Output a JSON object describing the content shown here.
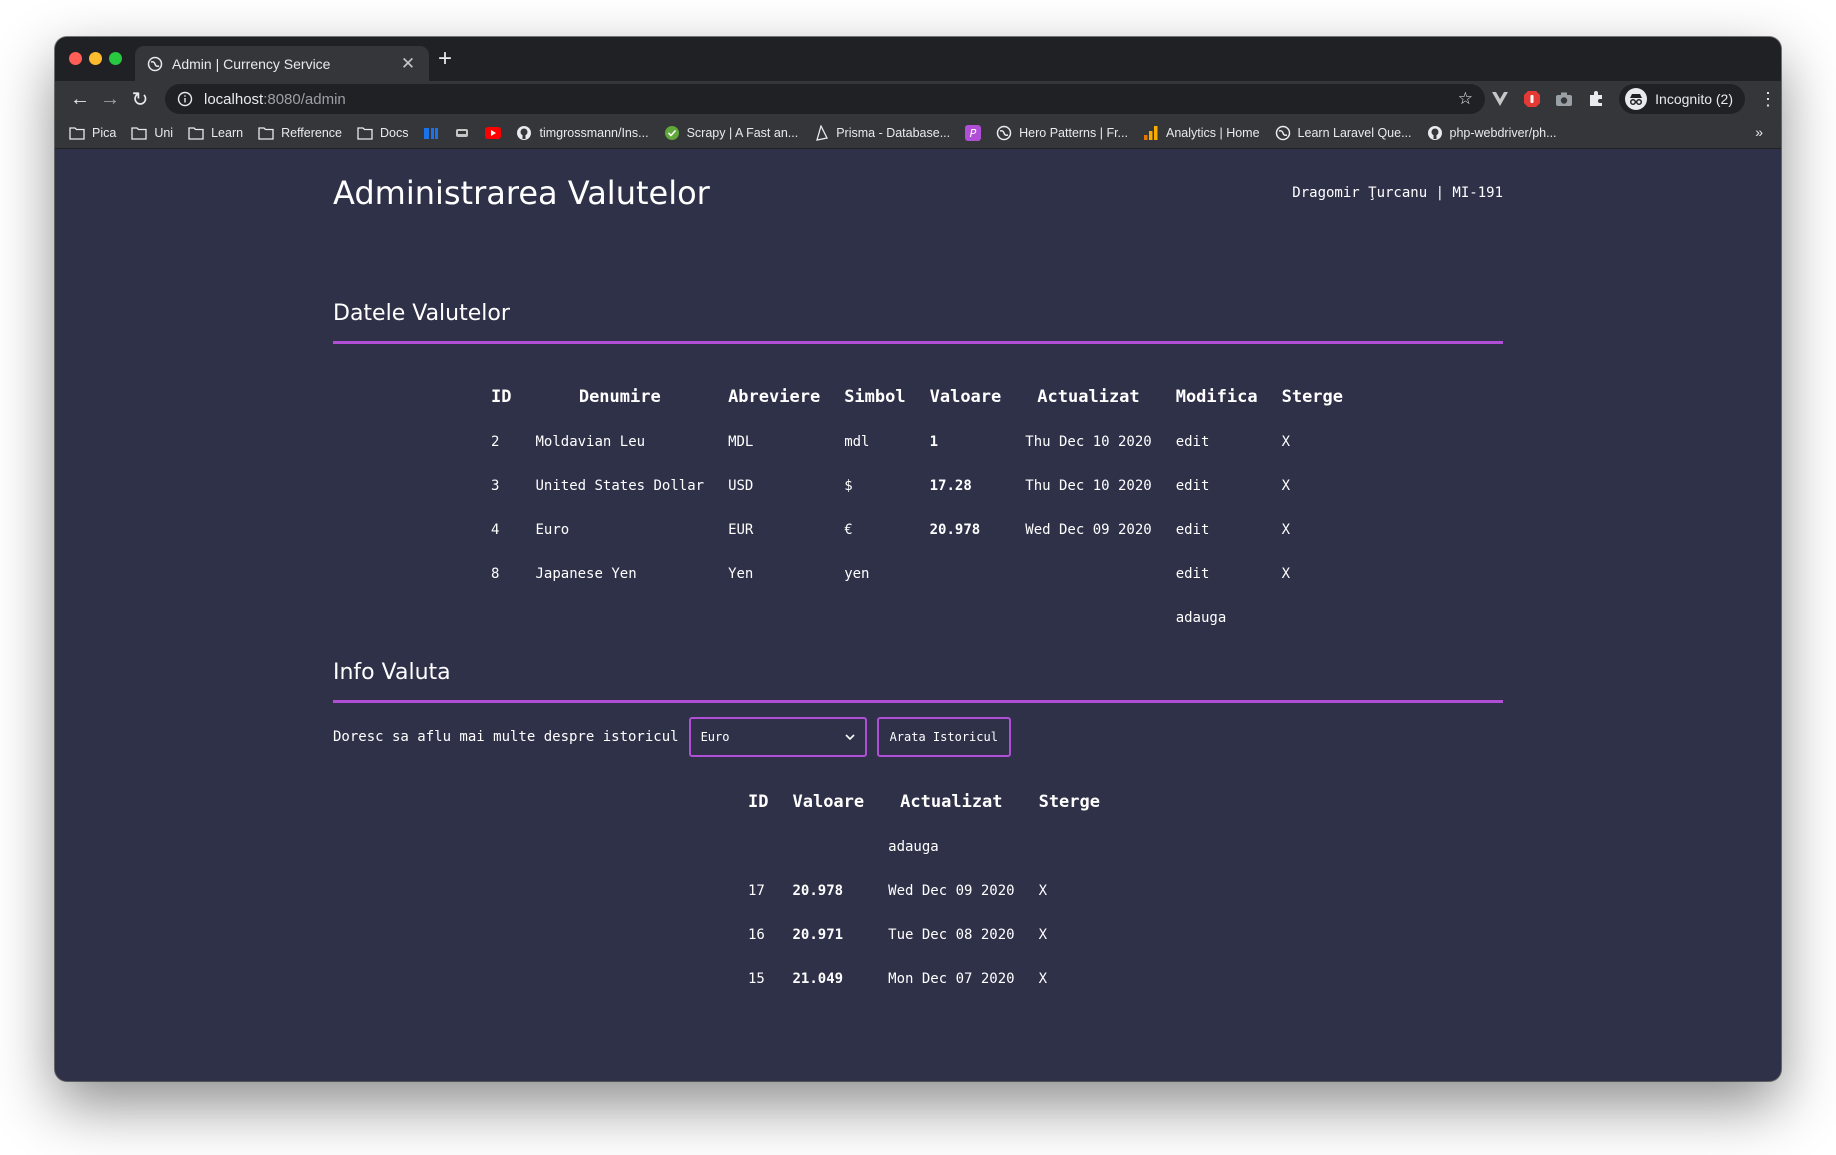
{
  "browser": {
    "tab_title": "Admin | Currency Service",
    "url_host": "localhost",
    "url_rest": ":8080/admin",
    "incognito_label": "Incognito (2)",
    "bookmarks": [
      {
        "label": "Pica",
        "icon": "folder-icon"
      },
      {
        "label": "Uni",
        "icon": "folder-icon"
      },
      {
        "label": "Learn",
        "icon": "folder-icon"
      },
      {
        "label": "Refference",
        "icon": "folder-icon"
      },
      {
        "label": "Docs",
        "icon": "folder-icon"
      },
      {
        "label": "",
        "icon": "blue-app-icon"
      },
      {
        "label": "",
        "icon": "car-icon"
      },
      {
        "label": "",
        "icon": "youtube-icon"
      },
      {
        "label": "timgrossmann/Ins...",
        "icon": "github-icon"
      },
      {
        "label": "Scrapy | A Fast an...",
        "icon": "scrapy-icon"
      },
      {
        "label": "Prisma - Database...",
        "icon": "prisma-icon"
      },
      {
        "label": "",
        "icon": "purple-p-icon"
      },
      {
        "label": "Hero Patterns | Fr...",
        "icon": "globe-icon"
      },
      {
        "label": "Analytics | Home",
        "icon": "analytics-icon"
      },
      {
        "label": "Learn Laravel Que...",
        "icon": "globe-icon"
      },
      {
        "label": "php-webdriver/ph...",
        "icon": "github-icon"
      }
    ],
    "more_label": "»"
  },
  "page": {
    "title": "Administrarea Valutelor",
    "author": "Dragomir Ţurcanu | MI-191"
  },
  "currencies_section": {
    "title": "Datele Valutelor",
    "headers": [
      "ID",
      "Denumire",
      "Abreviere",
      "Simbol",
      "Valoare",
      "Actualizat",
      "Modifica",
      "Sterge"
    ],
    "rows": [
      {
        "id": "2",
        "name": "Moldavian Leu",
        "abbr": "MDL",
        "symbol": "mdl",
        "value": "1",
        "updated": "Thu Dec 10 2020",
        "edit": "edit",
        "delete": "X"
      },
      {
        "id": "3",
        "name": "United States Dollar",
        "abbr": "USD",
        "symbol": "$",
        "value": "17.28",
        "updated": "Thu Dec 10 2020",
        "edit": "edit",
        "delete": "X"
      },
      {
        "id": "4",
        "name": "Euro",
        "abbr": "EUR",
        "symbol": "€",
        "value": "20.978",
        "updated": "Wed Dec 09 2020",
        "edit": "edit",
        "delete": "X"
      },
      {
        "id": "8",
        "name": "Japanese Yen",
        "abbr": "Yen",
        "symbol": "yen",
        "value": "",
        "updated": "",
        "edit": "edit",
        "delete": "X"
      }
    ],
    "add_label": "adauga"
  },
  "info_section": {
    "title": "Info Valuta",
    "prompt": "Doresc sa aflu mai multe despre istoricul",
    "selected_currency": "Euro",
    "button_label": "Arata Istoricul",
    "headers": [
      "ID",
      "Valoare",
      "Actualizat",
      "Sterge"
    ],
    "add_label": "adauga",
    "rows": [
      {
        "id": "17",
        "value": "20.978",
        "updated": "Wed Dec 09 2020",
        "delete": "X"
      },
      {
        "id": "16",
        "value": "20.971",
        "updated": "Tue Dec 08 2020",
        "delete": "X"
      },
      {
        "id": "15",
        "value": "21.049",
        "updated": "Mon Dec 07 2020",
        "delete": "X"
      }
    ]
  },
  "colors": {
    "page_bg": "#2f3149",
    "accent": "#b04fd6"
  }
}
